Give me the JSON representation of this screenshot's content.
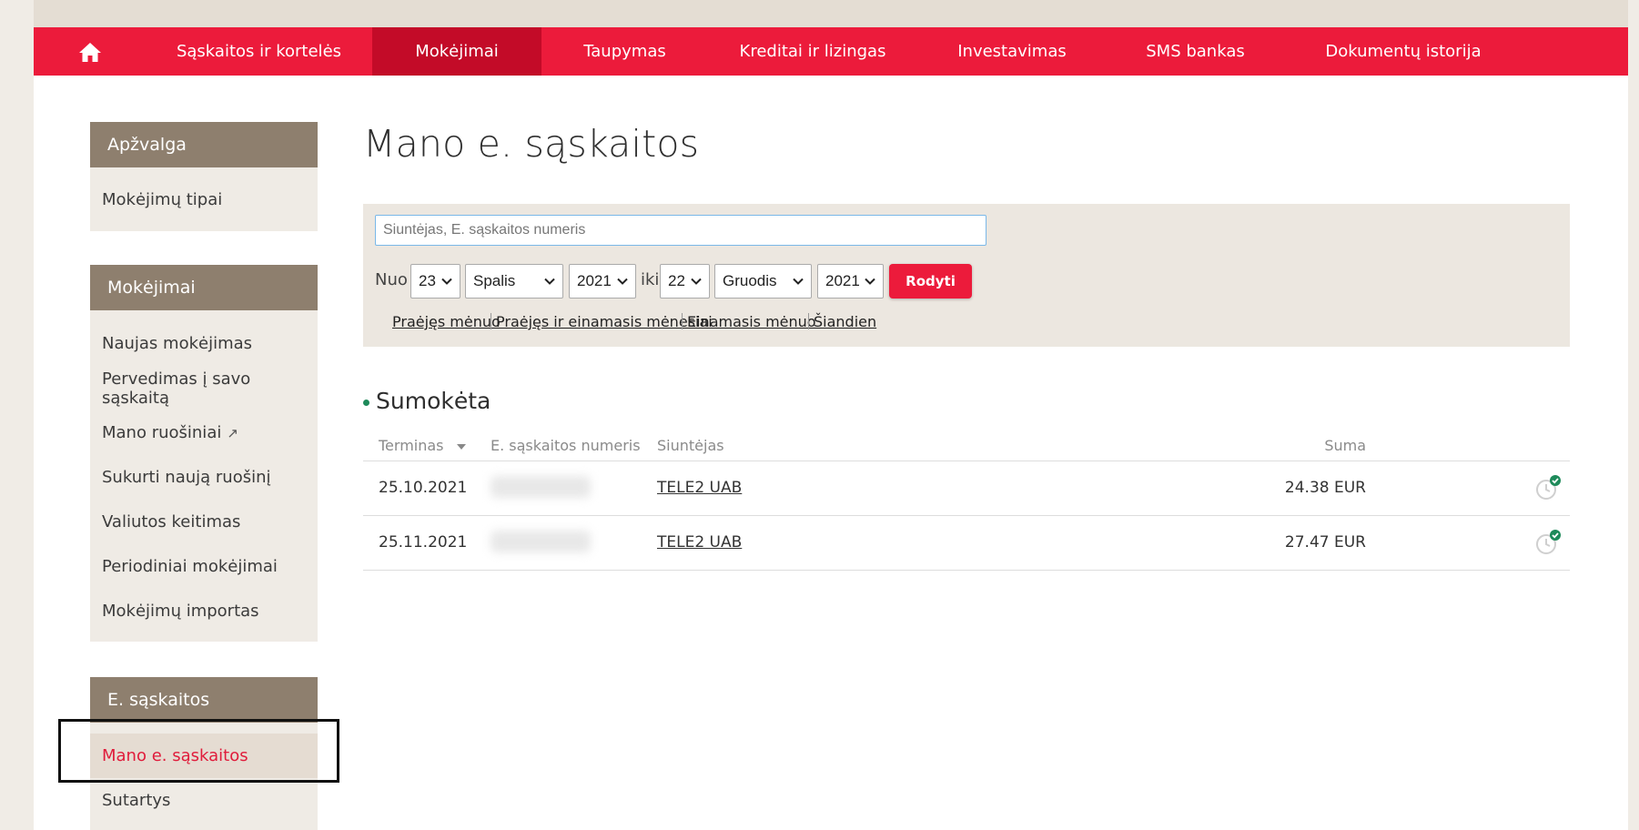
{
  "nav": {
    "home_icon": "home-icon",
    "items": [
      "Sąskaitos ir kortelės",
      "Mokėjimai",
      "Taupymas",
      "Kreditai ir lizingas",
      "Investavimas",
      "SMS bankas",
      "Dokumentų istorija"
    ],
    "active_index": 1
  },
  "sidebar": {
    "overview": {
      "title": "Apžvalga",
      "items": [
        "Mokėjimų tipai"
      ]
    },
    "payments": {
      "title": "Mokėjimai",
      "items": [
        "Naujas mokėjimas",
        "Pervedimas į savo sąskaitą",
        "Mano ruošiniai",
        "Sukurti naują ruošinį",
        "Valiutos keitimas",
        "Periodiniai mokėjimai",
        "Mokėjimų importas"
      ],
      "external_icon": "↗"
    },
    "einvoices": {
      "title": "E. sąskaitos",
      "items": [
        "Mano e. sąskaitos",
        "Sutartys"
      ],
      "active_index": 0
    }
  },
  "main": {
    "title": "Mano e. sąskaitos",
    "filter": {
      "search_placeholder": "Siuntėjas, E. sąskaitos numeris",
      "from_label": "Nuo",
      "to_label": "iki",
      "from": {
        "day": "23",
        "month": "Spalis",
        "year": "2021"
      },
      "to": {
        "day": "22",
        "month": "Gruodis",
        "year": "2021"
      },
      "show_button": "Rodyti",
      "quick_links": [
        "Praėjęs mėnuo",
        "Praėjęs ir einamasis mėnesiai",
        "Einamasis mėnuo",
        "Šiandien"
      ]
    },
    "section_title": "Sumokėta",
    "table": {
      "headers": {
        "due": "Terminas",
        "number": "E. sąskaitos numeris",
        "sender": "Siuntėjas",
        "amount": "Suma"
      },
      "rows": [
        {
          "due": "25.10.2021",
          "sender": "TELE2 UAB",
          "amount": "24.38 EUR"
        },
        {
          "due": "25.11.2021",
          "sender": "TELE2 UAB",
          "amount": "27.47 EUR"
        }
      ]
    }
  },
  "colors": {
    "brand_red": "#ec1b3b",
    "active_nav": "#c30b28",
    "sidebar_head": "#8e7f6e",
    "paid_green": "#1e8a5a"
  }
}
